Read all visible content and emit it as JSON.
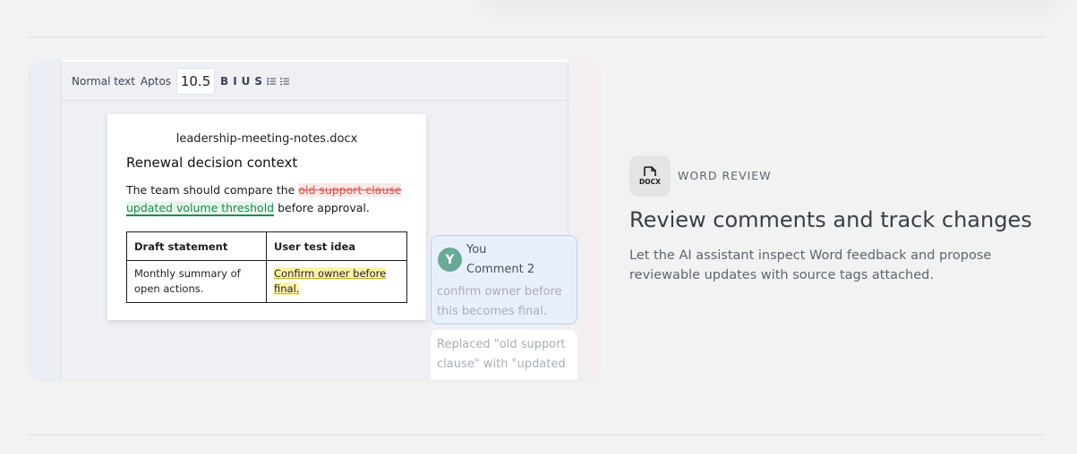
{
  "toolbar": {
    "style": "Normal text",
    "font": "Aptos",
    "size": "10.5",
    "bold": "B",
    "italic": "I",
    "underline": "U",
    "strike": "S",
    "icons": [
      "bulleted-list-icon",
      "numbered-list-icon"
    ]
  },
  "document": {
    "filename": "leadership-meeting-notes.docx",
    "heading": "Renewal decision context",
    "para_prefix": "The team should compare the",
    "deleted_text": "old support clause",
    "inserted_text": "updated volume threshold",
    "para_suffix": "before approval.",
    "table": {
      "headers": [
        "Draft statement",
        "User test idea"
      ],
      "rows": [
        [
          "Monthly summary of open actions.",
          "Confirm owner before final."
        ]
      ]
    }
  },
  "comment": {
    "avatar_initial": "Y",
    "author": "You",
    "title": "Comment 2",
    "body": "confirm owner before this becomes final."
  },
  "change_card": {
    "text": "Replaced \"old support clause\" with \"updated"
  },
  "feature": {
    "icon": "docx-file-icon",
    "icon_label": "DOCX",
    "eyebrow": "WORD REVIEW",
    "headline": "Review comments and track changes",
    "description": "Let the AI assistant inspect Word feedback and propose reviewable updates with source tags attached."
  },
  "colors": {
    "deleted": "#d9534f",
    "inserted": "#1f8a4c",
    "highlight": "#fdf3a6",
    "avatar": "#6aa89a",
    "comment_bg": "#e8f0fb"
  }
}
